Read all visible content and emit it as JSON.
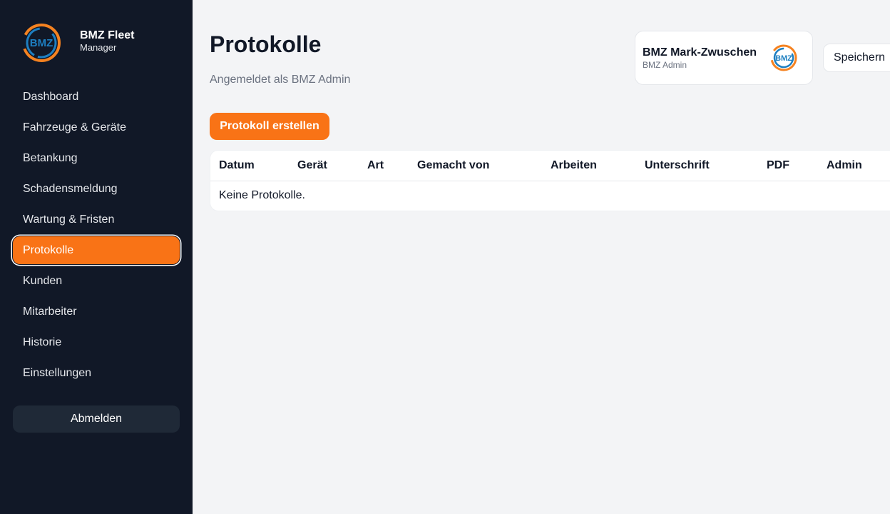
{
  "sidebar": {
    "brand": {
      "name": "BMZ Fleet",
      "sub": "Manager",
      "logo_text": "BMZ"
    },
    "items": [
      {
        "label": "Dashboard"
      },
      {
        "label": "Fahrzeuge & Geräte"
      },
      {
        "label": "Betankung"
      },
      {
        "label": "Schadensmeldung"
      },
      {
        "label": "Wartung & Fristen"
      },
      {
        "label": "Protokolle",
        "active": true
      },
      {
        "label": "Kunden"
      },
      {
        "label": "Mitarbeiter"
      },
      {
        "label": "Historie"
      },
      {
        "label": "Einstellungen"
      }
    ],
    "logout_label": "Abmelden"
  },
  "header": {
    "title": "Protokolle",
    "subtitle": "Angemeldet als BMZ Admin",
    "user_card": {
      "name": "BMZ Mark-Zwuschen",
      "role": "BMZ Admin"
    },
    "save_label": "Speichern"
  },
  "main": {
    "create_button": "Protokoll erstellen",
    "table": {
      "columns": [
        "Datum",
        "Gerät",
        "Art",
        "Gemacht von",
        "Arbeiten",
        "Unterschrift",
        "PDF",
        "Admin"
      ],
      "empty_text": "Keine Protokolle."
    }
  },
  "colors": {
    "sidebar_bg": "#111827",
    "accent": "#f97316",
    "logo_blue": "#1e7fc1",
    "logo_orange": "#f58220"
  }
}
